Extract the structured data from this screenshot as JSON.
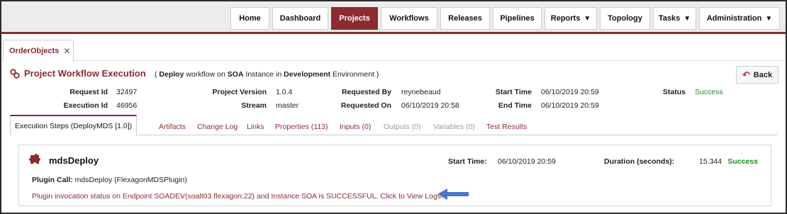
{
  "nav": {
    "items": [
      {
        "label": "Home",
        "active": false,
        "dropdown": false
      },
      {
        "label": "Dashboard",
        "active": false,
        "dropdown": false
      },
      {
        "label": "Projects",
        "active": true,
        "dropdown": false
      },
      {
        "label": "Workflows",
        "active": false,
        "dropdown": false
      },
      {
        "label": "Releases",
        "active": false,
        "dropdown": false
      },
      {
        "label": "Pipelines",
        "active": false,
        "dropdown": false
      },
      {
        "label": "Reports",
        "active": false,
        "dropdown": true
      },
      {
        "label": "Topology",
        "active": false,
        "dropdown": false
      },
      {
        "label": "Tasks",
        "active": false,
        "dropdown": true
      },
      {
        "label": "Administration",
        "active": false,
        "dropdown": true
      }
    ],
    "caret": "▼"
  },
  "object_tab": {
    "label": "OrderObjects",
    "close": "✕"
  },
  "page": {
    "title": "Project Workflow Execution",
    "subtitle": {
      "open": "(",
      "workflow": "Deploy",
      "mid1": "workflow on",
      "instance": "SOA",
      "mid2": "Instance in",
      "environment": "Development",
      "mid3": "Environment )"
    },
    "back_label": "Back",
    "back_icon": "↶"
  },
  "info": {
    "request_id_label": "Request Id",
    "request_id": "32497",
    "execution_id_label": "Execution Id",
    "execution_id": "46956",
    "project_version_label": "Project Version",
    "project_version": "1.0.4",
    "stream_label": "Stream",
    "stream": "master",
    "requested_by_label": "Requested By",
    "requested_by": "reynebeaud",
    "requested_on_label": "Requested On",
    "requested_on": "06/10/2019 20:58",
    "start_time_label": "Start Time",
    "start_time": "06/10/2019 20:59",
    "end_time_label": "End Time",
    "end_time": "06/10/2019 20:59",
    "status_label": "Status",
    "status": "Success"
  },
  "tabs": [
    {
      "label": "Execution Steps (DeployMDS [1.0])",
      "state": "active"
    },
    {
      "label": "Artifacts",
      "state": "enabled"
    },
    {
      "label": "Change Log",
      "state": "enabled"
    },
    {
      "label": "Links",
      "state": "enabled"
    },
    {
      "label": "Properties (113)",
      "state": "enabled"
    },
    {
      "label": "Inputs (0)",
      "state": "enabled"
    },
    {
      "label": "Outputs (0)",
      "state": "disabled"
    },
    {
      "label": "Variables (0)",
      "state": "disabled"
    },
    {
      "label": "Test Results",
      "state": "enabled"
    }
  ],
  "step": {
    "name": "mdsDeploy",
    "start_time_label": "Start Time:",
    "start_time": "06/10/2019 20:59",
    "duration_label": "Duration (seconds):",
    "duration": "15.344",
    "status": "Success",
    "plugin_call_label": "Plugin Call:",
    "plugin_call": "mdsDeploy (FlexagonMDSPlugin)",
    "message": "Plugin invocation status on Endpoint SOADEV(soalt03.flexagon:22) and Instance SOA is SUCCESSFUL. Click to View Logs."
  },
  "colors": {
    "brand": "#8c2b30",
    "success": "#1d8a1d",
    "annotation_arrow": "#4a78c4"
  },
  "icons": {
    "title": "workflow-gears-icon",
    "step": "puzzle-piece-icon",
    "annotation": "arrow-left-icon"
  }
}
